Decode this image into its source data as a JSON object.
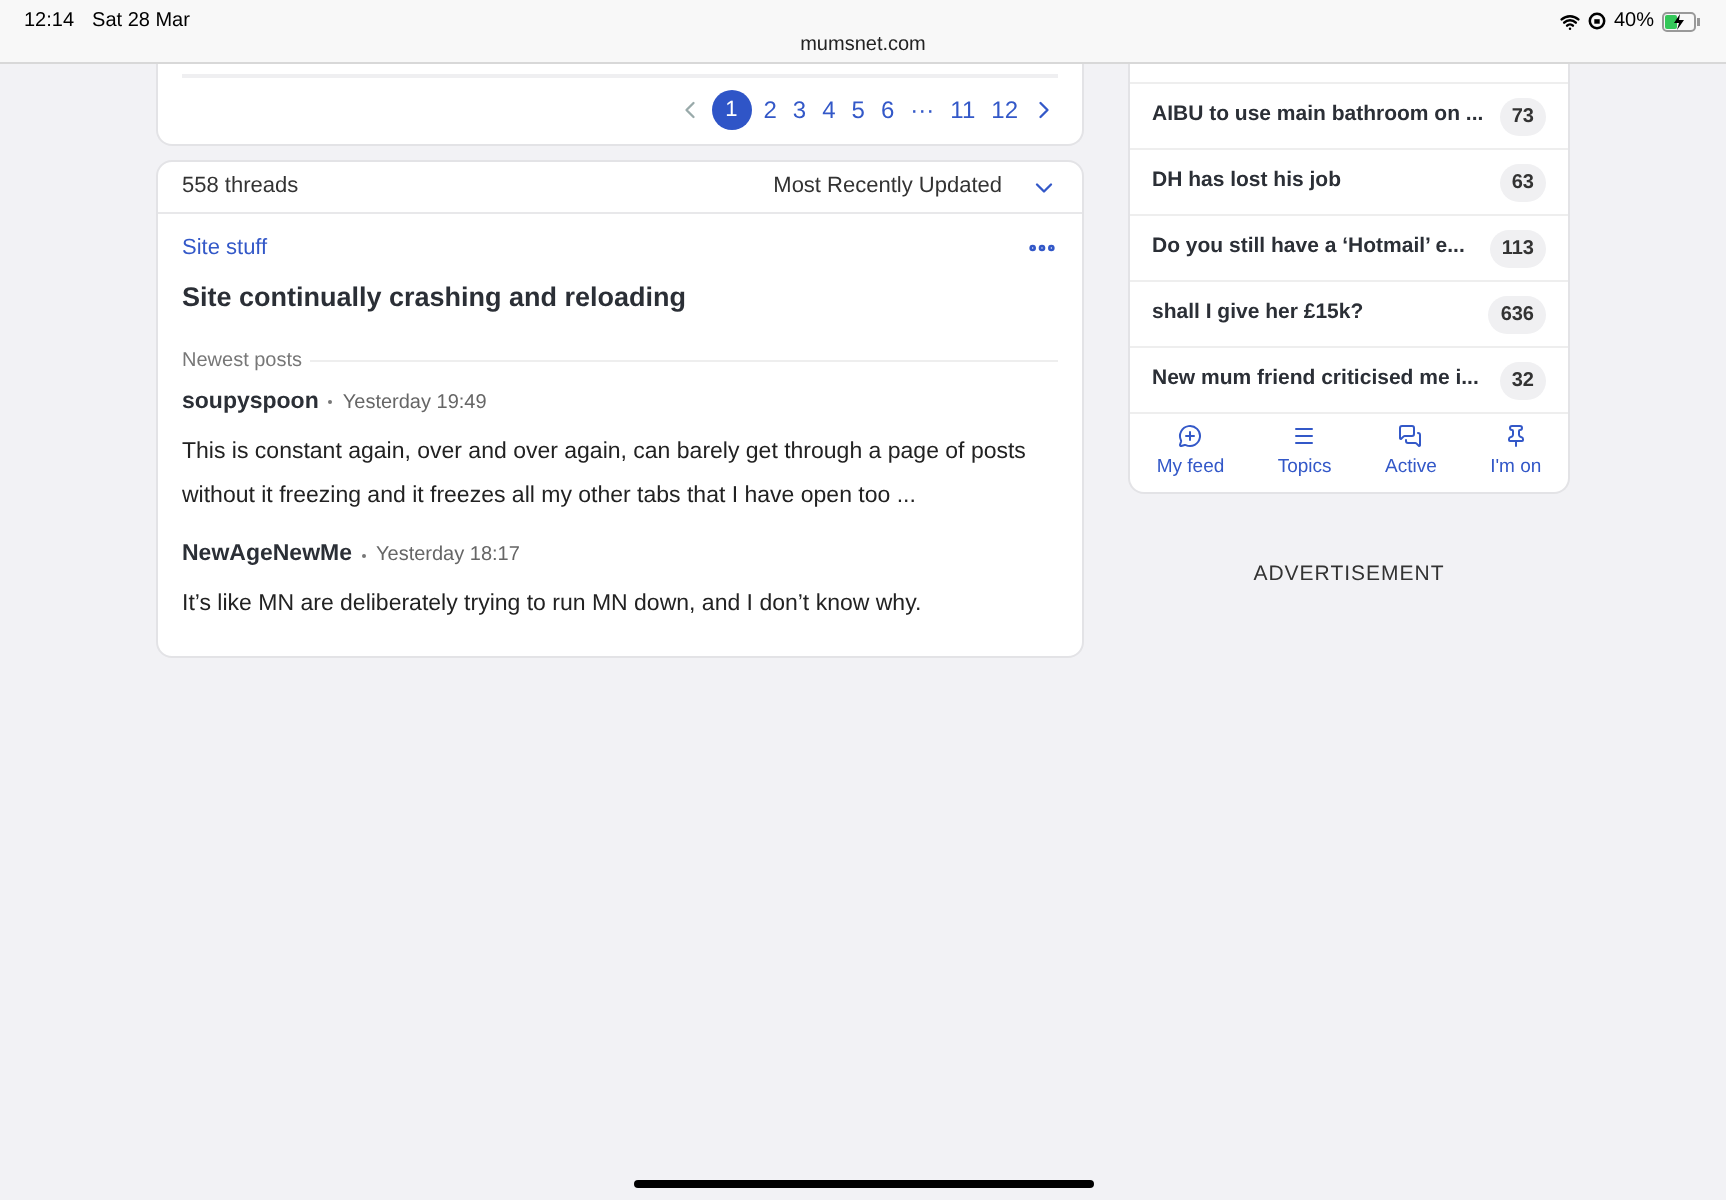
{
  "status_bar": {
    "time": "12:14",
    "date": "Sat 28 Mar",
    "battery": "40%",
    "address": "mumsnet.com"
  },
  "pagination": {
    "pages": [
      {
        "label": "1",
        "selected": true
      },
      {
        "label": "2",
        "selected": false
      },
      {
        "label": "3",
        "selected": false
      },
      {
        "label": "4",
        "selected": false
      },
      {
        "label": "5",
        "selected": false
      },
      {
        "label": "6",
        "selected": false
      },
      {
        "label": "···",
        "selected": false
      },
      {
        "label": "11",
        "selected": false
      },
      {
        "label": "12",
        "selected": false
      }
    ]
  },
  "thread_list": {
    "count": "558 threads",
    "sort": "Most Recently Updated",
    "thread": {
      "topic": "Site stuff",
      "title": "Site continually crashing and reloading",
      "section_label": "Newest posts",
      "posts": [
        {
          "author": "soupyspoon",
          "time": "Yesterday 19:49",
          "text": "This is constant again, over and over again, can barely get through a page of posts without it freezing and it freezes all my other tabs that I have open too ..."
        },
        {
          "author": "NewAgeNewMe",
          "time": "Yesterday 18:17",
          "text": "It’s like MN are deliberately trying to run MN down, and I don’t know why."
        }
      ]
    }
  },
  "trending": {
    "items": [
      {
        "title": "AIBU to use main bathroom on ...",
        "count": "73"
      },
      {
        "title": "DH has lost his job",
        "count": "63"
      },
      {
        "title": "Do you still have a ‘Hotmail’ e...",
        "count": "113"
      },
      {
        "title": "shall I give her £15k?",
        "count": "636"
      },
      {
        "title": "New mum friend criticised me i...",
        "count": "32"
      }
    ],
    "tabs": [
      {
        "kind": "feed",
        "label": "My feed"
      },
      {
        "kind": "topics",
        "label": "Topics"
      },
      {
        "kind": "active",
        "label": "Active"
      },
      {
        "kind": "pin",
        "label": "I'm on"
      }
    ]
  },
  "advertisement": "ADVERTISEMENT"
}
